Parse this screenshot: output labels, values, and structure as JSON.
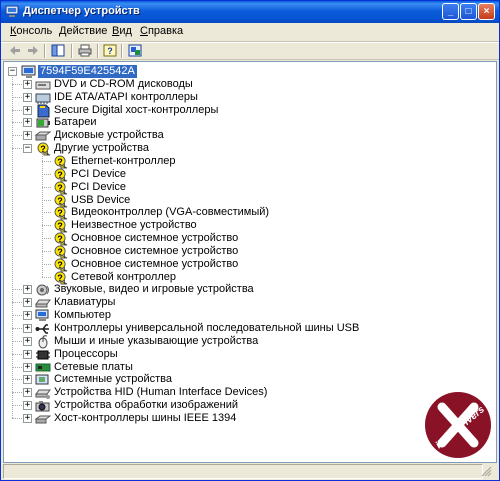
{
  "window": {
    "title": "Диспетчер устройств"
  },
  "menu": [
    "Консоль",
    "Действие",
    "Вид",
    "Справка"
  ],
  "toolbar": [
    "back-icon",
    "forward-icon",
    "show-hide-tree-icon",
    "print-icon",
    "help-icon",
    "properties-icon"
  ],
  "tree": {
    "root": "7594F59E425542A",
    "categories": [
      {
        "label": "DVD и CD-ROM дисководы",
        "icon": "cdrom-icon"
      },
      {
        "label": "IDE ATA/ATAPI контроллеры",
        "icon": "ide-controller-icon"
      },
      {
        "label": "Secure Digital хост-контроллеры",
        "icon": "sd-controller-icon"
      },
      {
        "label": "Батареи",
        "icon": "battery-icon"
      },
      {
        "label": "Дисковые устройства",
        "icon": "disk-drive-icon"
      },
      {
        "label": "Другие устройства",
        "icon": "unknown-device-icon",
        "expanded": true,
        "children": [
          "Ethernet-контроллер",
          "PCI Device",
          "PCI Device",
          "USB Device",
          "Видеоконтроллер (VGA-совместимый)",
          "Неизвестное устройство",
          "Основное системное устройство",
          "Основное системное устройство",
          "Основное системное устройство",
          "Сетевой контроллер"
        ]
      },
      {
        "label": "Звуковые, видео и игровые устройства",
        "icon": "sound-icon"
      },
      {
        "label": "Клавиатуры",
        "icon": "keyboard-icon"
      },
      {
        "label": "Компьютер",
        "icon": "computer-icon"
      },
      {
        "label": "Контроллеры универсальной последовательной шины USB",
        "icon": "usb-icon"
      },
      {
        "label": "Мыши и иные указывающие устройства",
        "icon": "mouse-icon"
      },
      {
        "label": "Процессоры",
        "icon": "processor-icon"
      },
      {
        "label": "Сетевые платы",
        "icon": "network-card-icon"
      },
      {
        "label": "Системные устройства",
        "icon": "system-device-icon"
      },
      {
        "label": "Устройства HID (Human Interface Devices)",
        "icon": "hid-icon"
      },
      {
        "label": "Устройства обработки изображений",
        "icon": "imaging-device-icon"
      },
      {
        "label": "Хост-контроллеры шины IEEE 1394",
        "icon": "ieee1394-icon"
      }
    ]
  },
  "watermark": {
    "text": "iXBT Drivers"
  },
  "colors": {
    "title_blue": "#0a5fd8",
    "selection": "#316ac5",
    "warning_yellow": "#ffe600",
    "window_bg": "#ece9d8"
  }
}
